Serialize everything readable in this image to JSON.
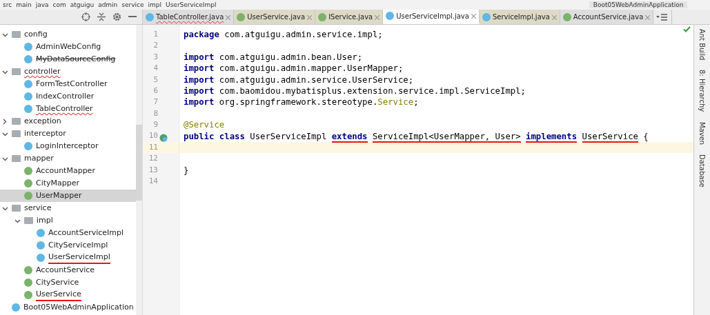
{
  "breadcrumbs": [
    "src",
    "main",
    "java",
    "com",
    "atguigu",
    "admin",
    "service",
    "impl",
    "UserServiceImpl"
  ],
  "run_config": "Boot05WebAdminApplication",
  "tabs": [
    {
      "label": "TableController.java",
      "kind": "class",
      "selected": false,
      "error": true,
      "color": "#dedede"
    },
    {
      "label": "UserService.java",
      "kind": "interface",
      "selected": false,
      "error": false,
      "color": "#dcdac4"
    },
    {
      "label": "IService.java",
      "kind": "interface",
      "selected": false,
      "error": false,
      "color": "#dcdac4"
    },
    {
      "label": "UserServiceImpl.java",
      "kind": "class",
      "selected": true,
      "error": false,
      "color": "#ffffff"
    },
    {
      "label": "ServiceImpl.java",
      "kind": "class",
      "selected": false,
      "error": false,
      "color": "#dcdac4"
    },
    {
      "label": "AccountService.java",
      "kind": "interface",
      "selected": false,
      "error": false,
      "color": "#dedede"
    }
  ],
  "tree": [
    {
      "label": "config",
      "kind": "folder",
      "expanded": true,
      "children": [
        {
          "label": "AdminWebConfig",
          "kind": "class"
        },
        {
          "label": "MyDataSourceConfig",
          "kind": "class",
          "deprecated": true
        }
      ]
    },
    {
      "label": "controller",
      "kind": "folder",
      "expanded": true,
      "error": true,
      "children": [
        {
          "label": "FormTestController",
          "kind": "class"
        },
        {
          "label": "IndexController",
          "kind": "class"
        },
        {
          "label": "TableController",
          "kind": "class",
          "error": true
        }
      ]
    },
    {
      "label": "exception",
      "kind": "folder",
      "expanded": false
    },
    {
      "label": "interceptor",
      "kind": "folder",
      "expanded": true,
      "children": [
        {
          "label": "LoginInterceptor",
          "kind": "class"
        }
      ]
    },
    {
      "label": "mapper",
      "kind": "folder",
      "expanded": true,
      "children": [
        {
          "label": "AccountMapper",
          "kind": "interface"
        },
        {
          "label": "CityMapper",
          "kind": "interface"
        },
        {
          "label": "UserMapper",
          "kind": "interface",
          "selected": true
        }
      ]
    },
    {
      "label": "service",
      "kind": "folder",
      "expanded": true,
      "children": [
        {
          "label": "impl",
          "kind": "folder",
          "expanded": true,
          "children": [
            {
              "label": "AccountServiceImpl",
              "kind": "class"
            },
            {
              "label": "CityServiceImpl",
              "kind": "class"
            },
            {
              "label": "UserServiceImpl",
              "kind": "class",
              "underlined": true
            }
          ]
        },
        {
          "label": "AccountService",
          "kind": "interface"
        },
        {
          "label": "CityService",
          "kind": "interface"
        },
        {
          "label": "UserService",
          "kind": "interface",
          "underlined": true
        }
      ]
    },
    {
      "label": "Boot05WebAdminApplication",
      "kind": "app"
    }
  ],
  "code_lines": [
    {
      "number": "1",
      "tokens": [
        {
          "text": "package",
          "kind": "keyword"
        },
        {
          "text": " com.atguigu.admin.service.impl;",
          "kind": "plain"
        }
      ]
    },
    {
      "number": "2"
    },
    {
      "number": "3",
      "tokens": [
        {
          "text": "import",
          "kind": "keyword"
        },
        {
          "text": " com.atguigu.admin.bean.User;",
          "kind": "plain"
        }
      ]
    },
    {
      "number": "4",
      "tokens": [
        {
          "text": "import",
          "kind": "keyword"
        },
        {
          "text": " com.atguigu.admin.mapper.UserMapper;",
          "kind": "plain"
        }
      ]
    },
    {
      "number": "5",
      "tokens": [
        {
          "text": "import",
          "kind": "keyword"
        },
        {
          "text": " com.atguigu.admin.service.UserService;",
          "kind": "plain"
        }
      ]
    },
    {
      "number": "6",
      "tokens": [
        {
          "text": "import",
          "kind": "keyword"
        },
        {
          "text": " com.baomidou.mybatisplus.extension.service.impl.ServiceImpl;",
          "kind": "plain"
        }
      ]
    },
    {
      "number": "7",
      "tokens": [
        {
          "text": "import",
          "kind": "keyword"
        },
        {
          "text": " org.springframework.stereotype.",
          "kind": "plain"
        },
        {
          "text": "Service",
          "kind": "annotation"
        },
        {
          "text": ";",
          "kind": "plain"
        }
      ]
    },
    {
      "number": "8"
    },
    {
      "number": "9",
      "tokens": [
        {
          "text": "@Service",
          "kind": "annotation"
        }
      ]
    },
    {
      "number": "10",
      "gutter_icon": true,
      "tokens": [
        {
          "text": "public class",
          "kind": "keyword"
        },
        {
          "text": " UserServiceImpl ",
          "kind": "plain"
        },
        {
          "text": "extends",
          "kind": "keyword",
          "underlined": true
        },
        {
          "text": " ServiceImpl<UserMapper, User>",
          "kind": "plain",
          "underlined": true
        },
        {
          "text": " implements",
          "kind": "keyword",
          "underlined": true
        },
        {
          "text": " UserService",
          "kind": "plain",
          "underlined": true
        },
        {
          "text": " {",
          "kind": "plain"
        }
      ]
    },
    {
      "number": "11",
      "current": true
    },
    {
      "number": "12"
    },
    {
      "number": "13",
      "tokens": [
        {
          "text": "}",
          "kind": "plain"
        }
      ]
    },
    {
      "number": "14"
    }
  ],
  "tool_windows": [
    "Ant Build",
    "8: Hierarchy",
    "Maven",
    "Database"
  ]
}
